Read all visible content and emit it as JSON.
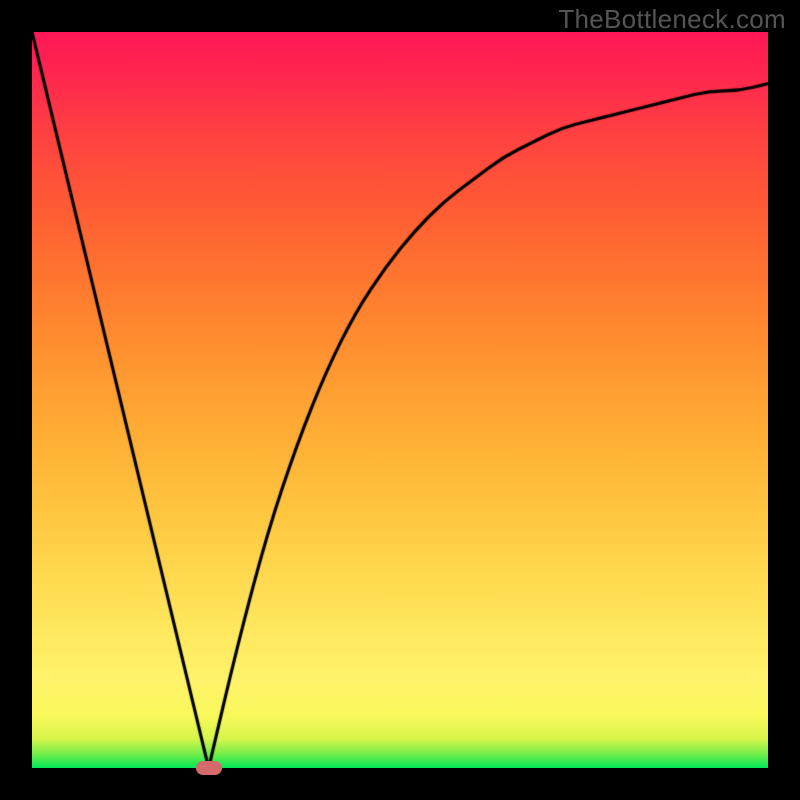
{
  "watermark": "TheBottleneck.com",
  "colors": {
    "page_bg": "#000000",
    "gradient_top": "#ff1758",
    "gradient_bottom": "#00e756",
    "marker_fill": "#d46a6a",
    "curve_stroke": "#000000"
  },
  "chart_data": {
    "type": "line",
    "title": "",
    "xlabel": "",
    "ylabel": "",
    "xlim": [
      0,
      1
    ],
    "ylim": [
      0,
      1
    ],
    "x_minimum": 0.24,
    "x": [
      0.0,
      0.04,
      0.08,
      0.12,
      0.16,
      0.2,
      0.24,
      0.28,
      0.32,
      0.36,
      0.4,
      0.44,
      0.48,
      0.52,
      0.56,
      0.6,
      0.64,
      0.68,
      0.72,
      0.76,
      0.8,
      0.84,
      0.88,
      0.92,
      0.96,
      1.0
    ],
    "values": [
      1.0,
      0.83,
      0.67,
      0.5,
      0.33,
      0.17,
      0.0,
      0.17,
      0.32,
      0.44,
      0.54,
      0.62,
      0.68,
      0.73,
      0.77,
      0.8,
      0.83,
      0.85,
      0.87,
      0.88,
      0.89,
      0.9,
      0.91,
      0.92,
      0.92,
      0.93
    ]
  }
}
